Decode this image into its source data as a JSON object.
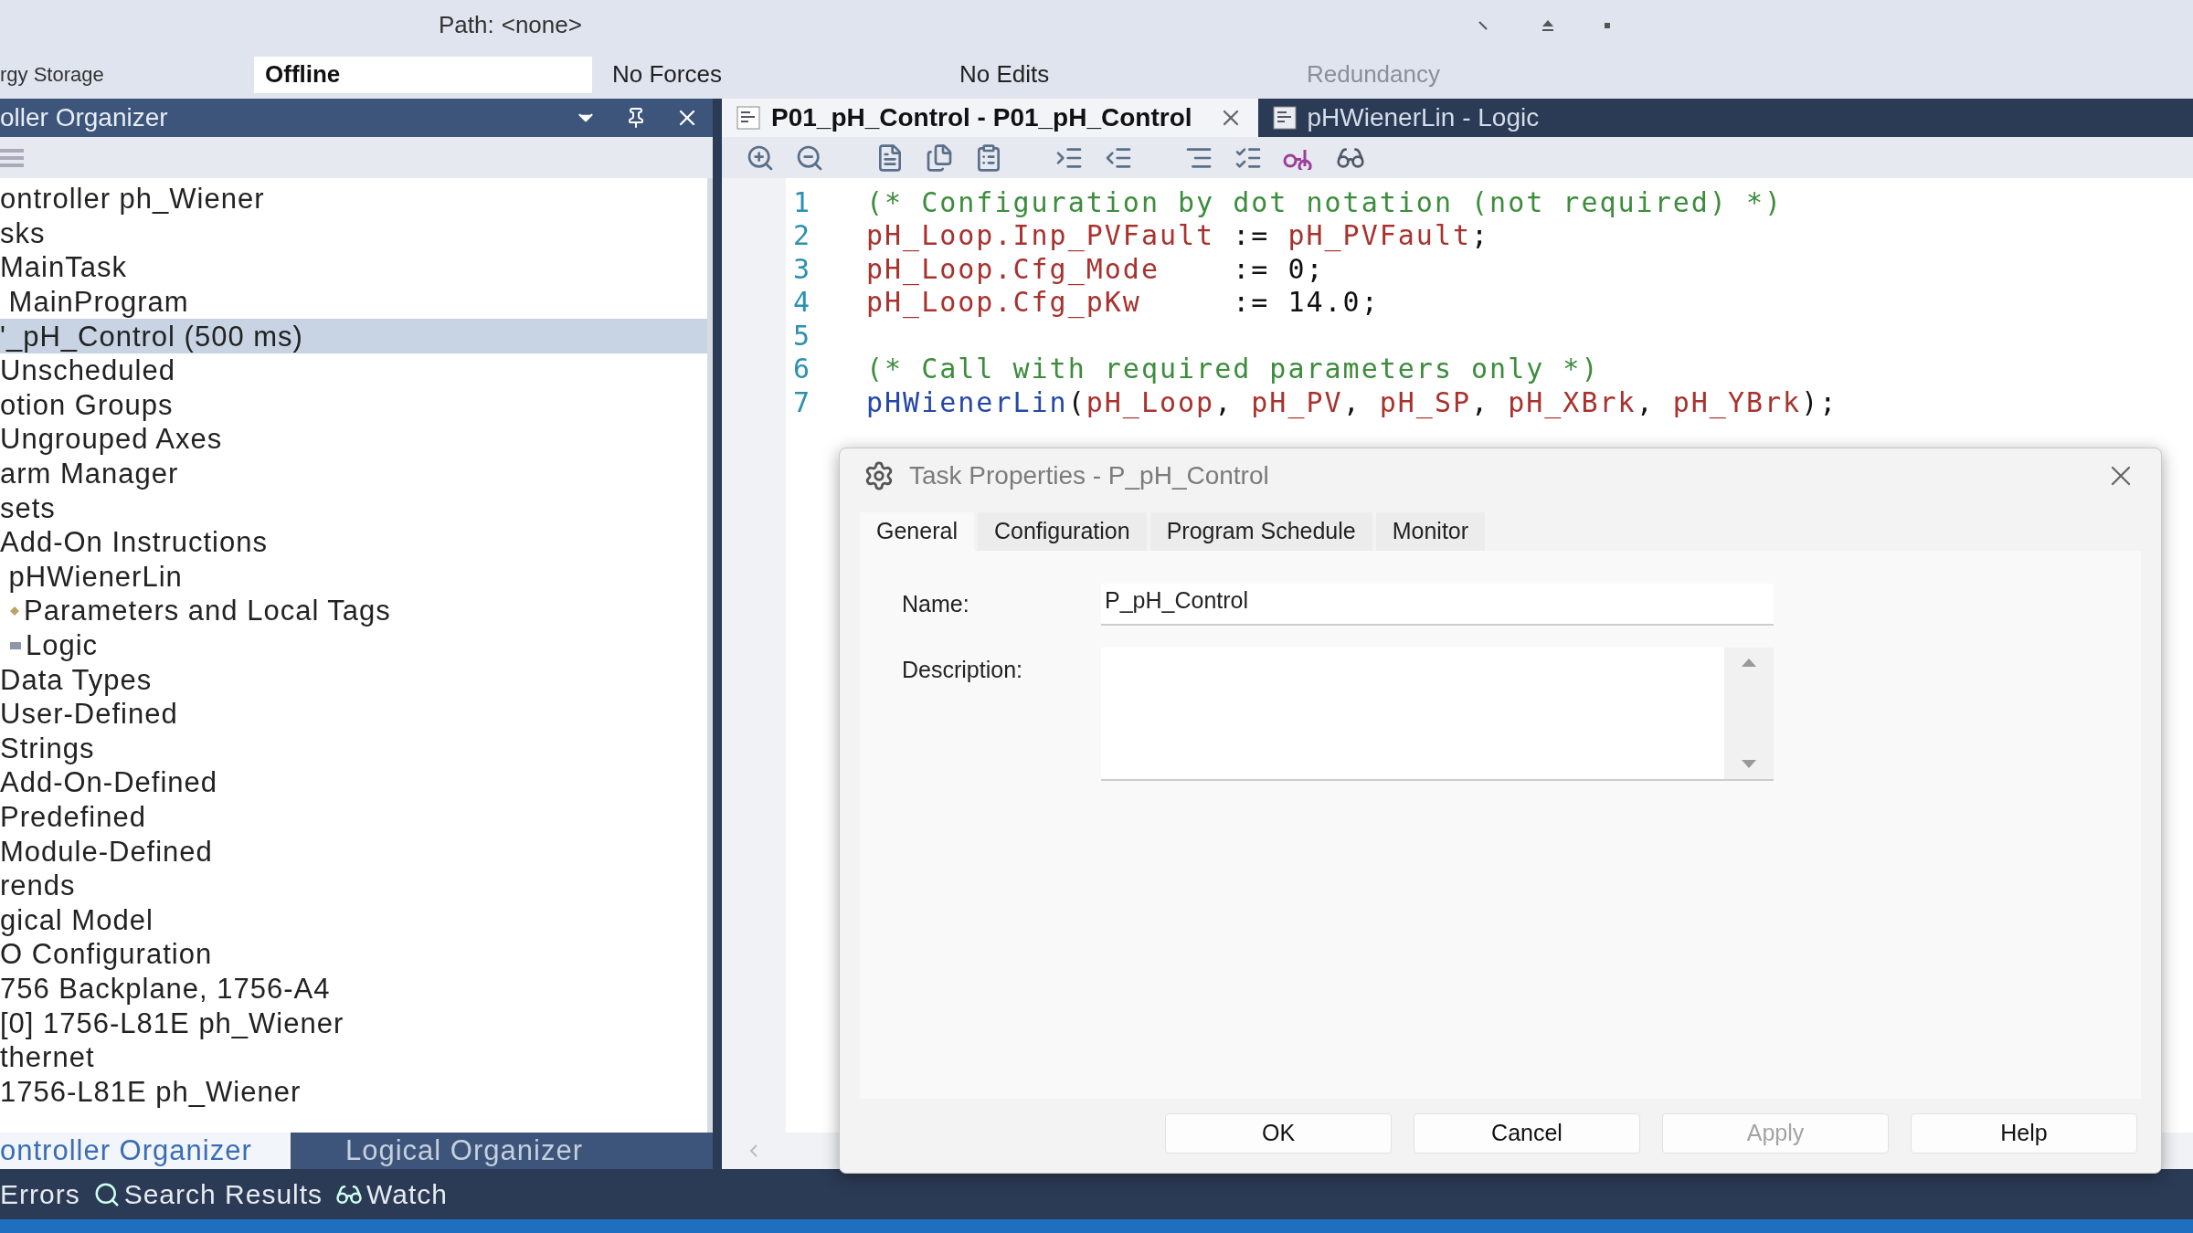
{
  "top_bar": {
    "path_label": "Path:",
    "path_value": "<none>",
    "left_label": "rgy Storage",
    "statuses": [
      {
        "text": "Offline",
        "kind": "field"
      },
      {
        "text": "No Forces",
        "kind": "plain"
      },
      {
        "text": "No Edits",
        "kind": "plain"
      },
      {
        "text": "Redundancy",
        "kind": "disabled"
      }
    ]
  },
  "organizer": {
    "title": "oller Organizer",
    "tree": [
      {
        "label": "ontroller ph_Wiener",
        "kind": "node",
        "selected": false
      },
      {
        "label": "sks",
        "kind": "node",
        "selected": false
      },
      {
        "label": "MainTask",
        "kind": "node",
        "selected": false
      },
      {
        "label": " MainProgram",
        "kind": "node",
        "selected": false
      },
      {
        "label": "'_pH_Control (500 ms)",
        "kind": "node",
        "selected": true
      },
      {
        "label": "Unscheduled",
        "kind": "node",
        "selected": false
      },
      {
        "label": "otion Groups",
        "kind": "node",
        "selected": false
      },
      {
        "label": "Ungrouped Axes",
        "kind": "node",
        "selected": false
      },
      {
        "label": "arm Manager",
        "kind": "node",
        "selected": false
      },
      {
        "label": "sets",
        "kind": "node",
        "selected": false
      },
      {
        "label": "Add-On Instructions",
        "kind": "node",
        "selected": false
      },
      {
        "label": " pHWienerLin",
        "kind": "node",
        "selected": false
      },
      {
        "label": "Parameters and Local Tags",
        "kind": "tags",
        "selected": false
      },
      {
        "label": "Logic",
        "kind": "logic",
        "selected": false
      },
      {
        "label": "Data Types",
        "kind": "node",
        "selected": false
      },
      {
        "label": "User-Defined",
        "kind": "node",
        "selected": false
      },
      {
        "label": "Strings",
        "kind": "node",
        "selected": false
      },
      {
        "label": "Add-On-Defined",
        "kind": "node",
        "selected": false
      },
      {
        "label": "Predefined",
        "kind": "node",
        "selected": false
      },
      {
        "label": "Module-Defined",
        "kind": "node",
        "selected": false
      },
      {
        "label": "rends",
        "kind": "node",
        "selected": false
      },
      {
        "label": "gical Model",
        "kind": "node",
        "selected": false
      },
      {
        "label": "O Configuration",
        "kind": "node",
        "selected": false
      },
      {
        "label": "756 Backplane, 1756-A4",
        "kind": "node",
        "selected": false
      },
      {
        "label": "[0] 1756-L81E ph_Wiener",
        "kind": "node",
        "selected": false
      },
      {
        "label": "thernet",
        "kind": "node",
        "selected": false
      },
      {
        "label": "1756-L81E ph_Wiener",
        "kind": "node",
        "selected": false
      }
    ],
    "tabs": [
      {
        "label": "ontroller Organizer",
        "selected": true
      },
      {
        "label": "Logical Organizer",
        "selected": false
      }
    ]
  },
  "bottom_bar": [
    {
      "label": "Errors",
      "kind": "plain"
    },
    {
      "label": "Search Results",
      "kind": "search"
    },
    {
      "label": "Watch",
      "kind": "watch"
    }
  ],
  "editor": {
    "tabs": [
      {
        "label": "P01_pH_Control - P01_pH_Control",
        "selected": true
      },
      {
        "label": "pHWienerLin - Logic",
        "selected": false
      }
    ],
    "lines": [
      {
        "number": "1",
        "tokens": [
          {
            "kind": "comment",
            "text": "(* Configuration by dot notation (not required) *)"
          }
        ]
      },
      {
        "number": "2",
        "tokens": [
          {
            "kind": "tag",
            "text": "pH_Loop.Inp_PVFault"
          },
          {
            "kind": "plain",
            "text": " := "
          },
          {
            "kind": "tag",
            "text": "pH_PVFault"
          },
          {
            "kind": "plain",
            "text": ";"
          }
        ]
      },
      {
        "number": "3",
        "tokens": [
          {
            "kind": "tag",
            "text": "pH_Loop.Cfg_Mode"
          },
          {
            "kind": "plain",
            "text": "    := 0;"
          }
        ]
      },
      {
        "number": "4",
        "tokens": [
          {
            "kind": "tag",
            "text": "pH_Loop.Cfg_pKw"
          },
          {
            "kind": "plain",
            "text": "     := 14.0;"
          }
        ]
      },
      {
        "number": "5"
      },
      {
        "number": "6",
        "tokens": [
          {
            "kind": "comment",
            "text": "(* Call with required parameters only *)"
          }
        ]
      },
      {
        "number": "7",
        "tokens": [
          {
            "kind": "function",
            "text": "pHWienerLin"
          },
          {
            "kind": "plain",
            "text": "("
          },
          {
            "kind": "tag",
            "text": "pH_Loop"
          },
          {
            "kind": "plain",
            "text": ", "
          },
          {
            "kind": "tag",
            "text": "pH_PV"
          },
          {
            "kind": "plain",
            "text": ", "
          },
          {
            "kind": "tag",
            "text": "pH_SP"
          },
          {
            "kind": "plain",
            "text": ", "
          },
          {
            "kind": "tag",
            "text": "pH_XBrk"
          },
          {
            "kind": "plain",
            "text": ", "
          },
          {
            "kind": "tag",
            "text": "pH_YBrk"
          },
          {
            "kind": "plain",
            "text": ");"
          }
        ]
      }
    ]
  },
  "dialog": {
    "title": "Task Properties - P_pH_Control",
    "tabs": [
      {
        "label": "General",
        "selected": true
      },
      {
        "label": "Configuration",
        "selected": false
      },
      {
        "label": "Program Schedule",
        "selected": false
      },
      {
        "label": "Monitor",
        "selected": false
      }
    ],
    "name_label": "Name:",
    "name_value": "P_pH_Control",
    "description_label": "Description:",
    "buttons": [
      {
        "label": "OK",
        "disabled": false
      },
      {
        "label": "Cancel",
        "disabled": false
      },
      {
        "label": "Apply",
        "disabled": true
      },
      {
        "label": "Help",
        "disabled": false
      }
    ]
  }
}
